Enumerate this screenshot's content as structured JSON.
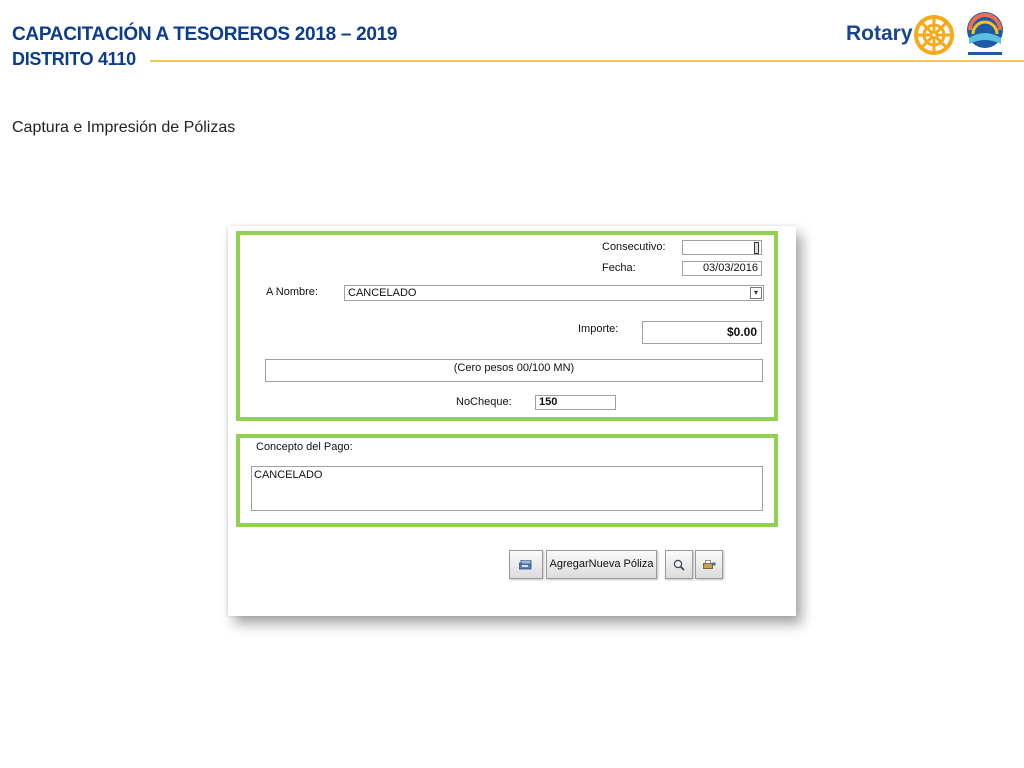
{
  "header": {
    "title_line1": "CAPACITACIÓN A TESOREROS 2018 – 2019",
    "title_line2": "DISTRITO 4110",
    "brand": "Rotary",
    "brand_color": "#17458f",
    "accent_line_color": "#f2c94c"
  },
  "subtitle": "Captura e Impresión de Pólizas",
  "form": {
    "highlight_color": "#92d050",
    "consecutivo": {
      "label": "Consecutivo:",
      "value": ""
    },
    "fecha": {
      "label": "Fecha:",
      "value": "03/03/2016"
    },
    "a_nombre": {
      "label": "A Nombre:",
      "value": "CANCELADO"
    },
    "importe": {
      "label": "Importe:",
      "value": "$0.00"
    },
    "importe_letras": "(Cero pesos 00/100 MN)",
    "no_cheque": {
      "label": "NoCheque:",
      "value": "150"
    },
    "concepto": {
      "label": "Concepto del Pago:",
      "value": "CANCELADO"
    }
  },
  "buttons": {
    "save_icon": "save-disk-icon",
    "agregar_label": "AgregarNueva Póliza",
    "search_icon": "magnifier-icon",
    "print_icon": "print-icon"
  }
}
